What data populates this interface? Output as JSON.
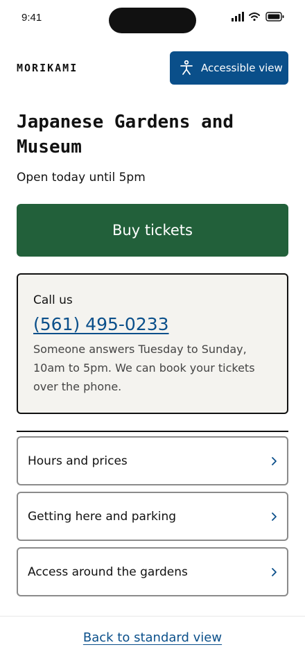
{
  "status_bar": {
    "time": "9:41"
  },
  "header": {
    "logo": "MORIKAMI",
    "accessible_label": "Accessible view"
  },
  "page": {
    "title": "Japanese Gardens and Museum",
    "open_status": "Open today until 5pm",
    "buy_label": "Buy tickets"
  },
  "call": {
    "title": "Call us",
    "phone": "(561) 495-0233",
    "description": "Someone answers Tuesday to Sunday, 10am to 5pm. We can book your tickets over the phone."
  },
  "links": [
    {
      "label": "Hours and prices"
    },
    {
      "label": "Getting here and parking"
    },
    {
      "label": "Access around the gardens"
    }
  ],
  "footer": {
    "back_label": "Back to standard view"
  },
  "colors": {
    "accent_blue": "#0a4f8a",
    "brand_green": "#22603a",
    "card_bg": "#f4f3ef"
  }
}
